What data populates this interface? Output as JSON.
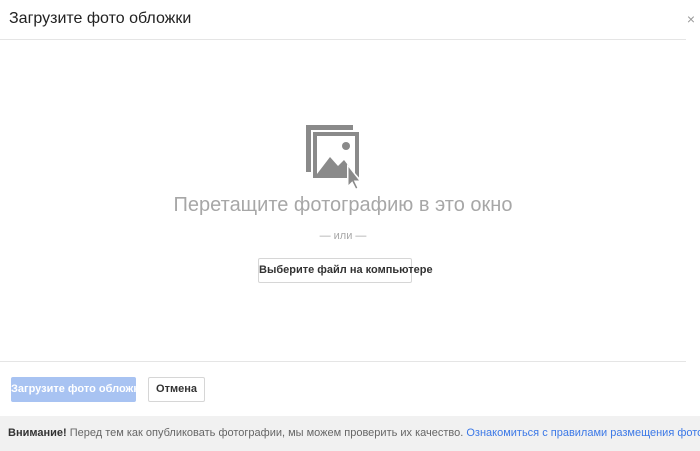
{
  "dialog": {
    "title": "Загрузите фото обложки",
    "close_label": "×"
  },
  "dropzone": {
    "icon": "image-drag-icon",
    "drag_text": "Перетащите фотографию в это окно",
    "or_text": "— или —",
    "choose_file_label": "Выберите файл на компьютере"
  },
  "footer": {
    "upload_label": "Загрузите фото обложки",
    "cancel_label": "Отмена"
  },
  "notice": {
    "prefix": "Внимание!",
    "text": " Перед тем как опубликовать фотографии, мы можем проверить их качество. ",
    "link": "Ознакомиться с правилами размещения фотографий."
  },
  "colors": {
    "primary_disabled": "#a8c3f2",
    "link": "#3b78e7",
    "icon_gray": "#8a8a8a"
  }
}
